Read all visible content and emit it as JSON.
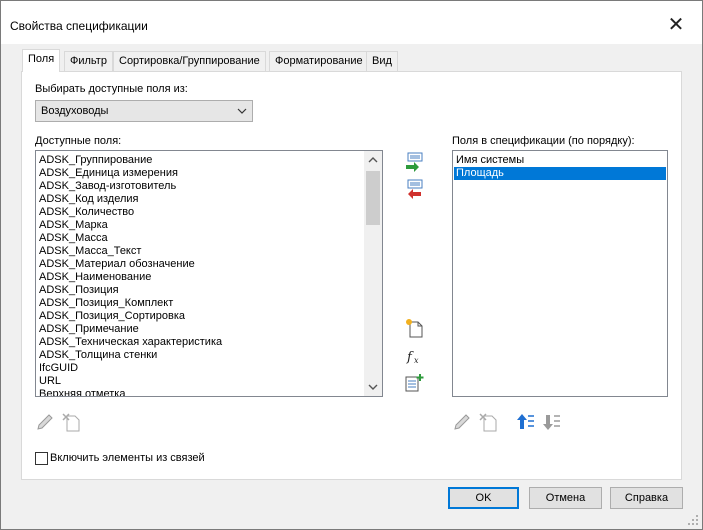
{
  "window": {
    "title": "Свойства спецификации",
    "close_glyph": "✕"
  },
  "tabs": [
    {
      "label": "Поля",
      "active": true
    },
    {
      "label": "Фильтр",
      "active": false
    },
    {
      "label": "Сортировка/Группирование",
      "active": false
    },
    {
      "label": "Форматирование",
      "active": false
    },
    {
      "label": "Вид",
      "active": false
    }
  ],
  "source": {
    "label": "Выбирать доступные поля из:",
    "selected": "Воздуховоды"
  },
  "available": {
    "label": "Доступные поля:",
    "items": [
      "ADSK_Группирование",
      "ADSK_Единица измерения",
      "ADSK_Завод-изготовитель",
      "ADSK_Код изделия",
      "ADSK_Количество",
      "ADSK_Марка",
      "ADSK_Масса",
      "ADSK_Масса_Текст",
      "ADSK_Материал обозначение",
      "ADSK_Наименование",
      "ADSK_Позиция",
      "ADSK_Позиция_Комплект",
      "ADSK_Позиция_Сортировка",
      "ADSK_Примечание",
      "ADSK_Техническая характеристика",
      "ADSK_Толщина стенки",
      "IfcGUID",
      "URL",
      "Верхняя отметка"
    ]
  },
  "selected_fields": {
    "label": "Поля в спецификации (по порядку):",
    "items": [
      {
        "name": "Имя системы",
        "selected": false
      },
      {
        "name": "Площадь",
        "selected": true
      }
    ]
  },
  "include_links": {
    "label": "Включить элементы из связей",
    "checked": false
  },
  "buttons": {
    "ok": "OK",
    "cancel": "Отмена",
    "help": "Справка"
  },
  "colors": {
    "selection": "#0078d7",
    "add_arrow": "#2e9b3c",
    "remove_arrow": "#d0312d"
  }
}
